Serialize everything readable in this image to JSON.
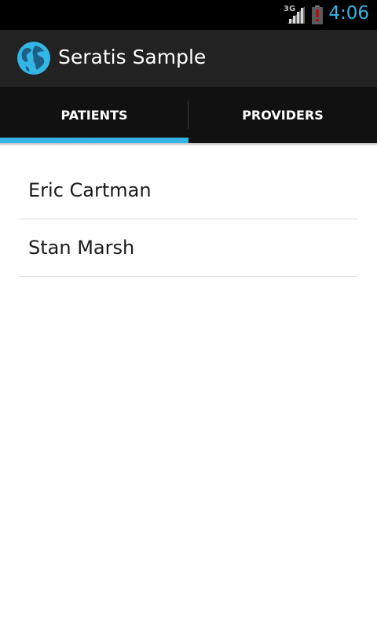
{
  "status_bar": {
    "network": "3G",
    "time": "4:06",
    "time_color": "#33b5e5"
  },
  "action_bar": {
    "title": "Seratis Sample",
    "icon": "globe-icon"
  },
  "tabs": [
    {
      "label": "PATIENTS",
      "selected": true
    },
    {
      "label": "PROVIDERS",
      "selected": false
    }
  ],
  "accent_color": "#33b5e5",
  "patients": [
    {
      "name": "Eric Cartman"
    },
    {
      "name": "Stan Marsh"
    }
  ]
}
